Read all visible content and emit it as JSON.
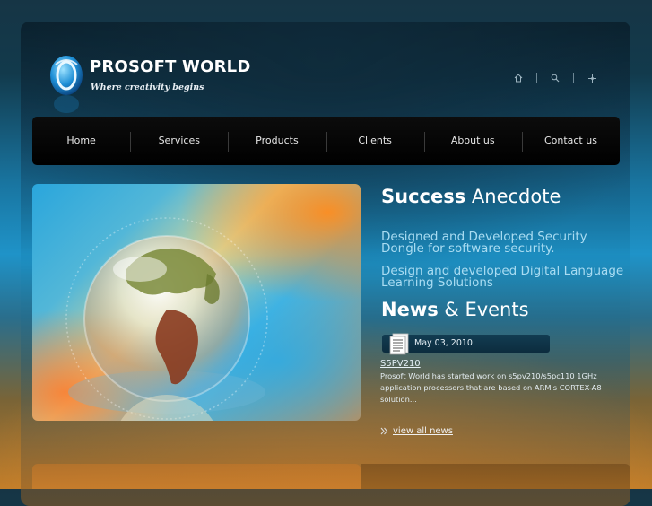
{
  "brand": {
    "name": "PROSOFT WORLD",
    "tagline": "Where creativity begins"
  },
  "top_icons": [
    "home-icon",
    "search-icon",
    "sitemap-icon"
  ],
  "nav": {
    "items": [
      {
        "label": "Home"
      },
      {
        "label": "Services"
      },
      {
        "label": "Products"
      },
      {
        "label": "Clients"
      },
      {
        "label": "About us"
      },
      {
        "label": "Contact us"
      }
    ]
  },
  "success": {
    "title_bold": "Success",
    "title_rest": " Anecdote",
    "items": [
      "Designed and Developed Security Dongle for software security.",
      "Design and developed Digital Language Learning Solutions"
    ]
  },
  "news": {
    "title_bold": "News",
    "title_rest": " & Events",
    "date": "May 03, 2010",
    "link": "S5PV210",
    "description": "Prosoft World has started work on s5pv210/s5pc110 1GHz application processors that are based on ARM's CORTEX-A8 solution...",
    "view_all": "view all news"
  },
  "colors": {
    "accent_text": "#a9dcf2",
    "nav_bg": "#000000"
  }
}
